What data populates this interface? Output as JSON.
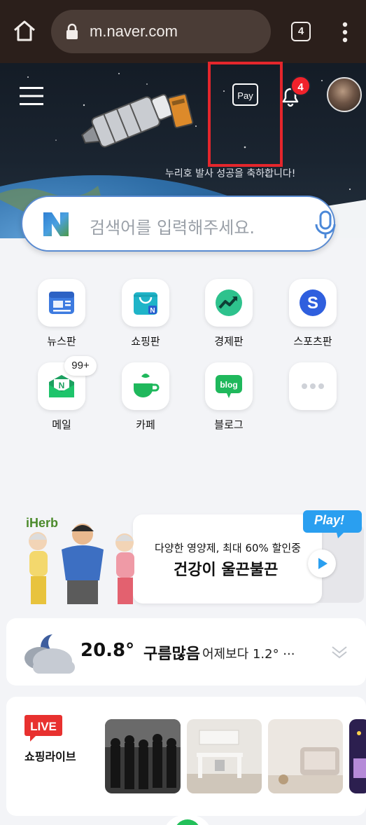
{
  "browser": {
    "url": "m.naver.com",
    "tab_count": "4"
  },
  "hero": {
    "caption": "누리호 발사 성공을 축하합니다!",
    "pay_label": "Pay",
    "notification_count": "4"
  },
  "search": {
    "placeholder": "검색어를 입력해주세요."
  },
  "shortcuts": [
    {
      "label": "뉴스판",
      "icon": "news-icon"
    },
    {
      "label": "쇼핑판",
      "icon": "shopping-bag-icon"
    },
    {
      "label": "경제판",
      "icon": "trend-chart-icon"
    },
    {
      "label": "스포츠판",
      "icon": "sports-s-icon"
    },
    {
      "label": "메일",
      "icon": "mail-icon",
      "badge": "99+"
    },
    {
      "label": "카페",
      "icon": "cafe-cup-icon"
    },
    {
      "label": "블로그",
      "icon": "blog-bubble-icon",
      "icon_text": "blog"
    },
    {
      "label": "",
      "icon": "more-dots-icon"
    }
  ],
  "ad": {
    "brand": "iHerb",
    "line1": "다양한 영양제, 최대 60% 할인중",
    "line2": "건강이 울끈불끈",
    "play_label": "Play!"
  },
  "weather": {
    "temperature": "20.8°",
    "condition": "구름많음",
    "comparison": "어제보다 1.2° ···"
  },
  "live_shopping": {
    "badge": "LIVE",
    "title": "쇼핑라이브"
  },
  "colors": {
    "naver_green": "#03c75a",
    "highlight_red": "#e4262c",
    "badge_red": "#f0222b"
  }
}
